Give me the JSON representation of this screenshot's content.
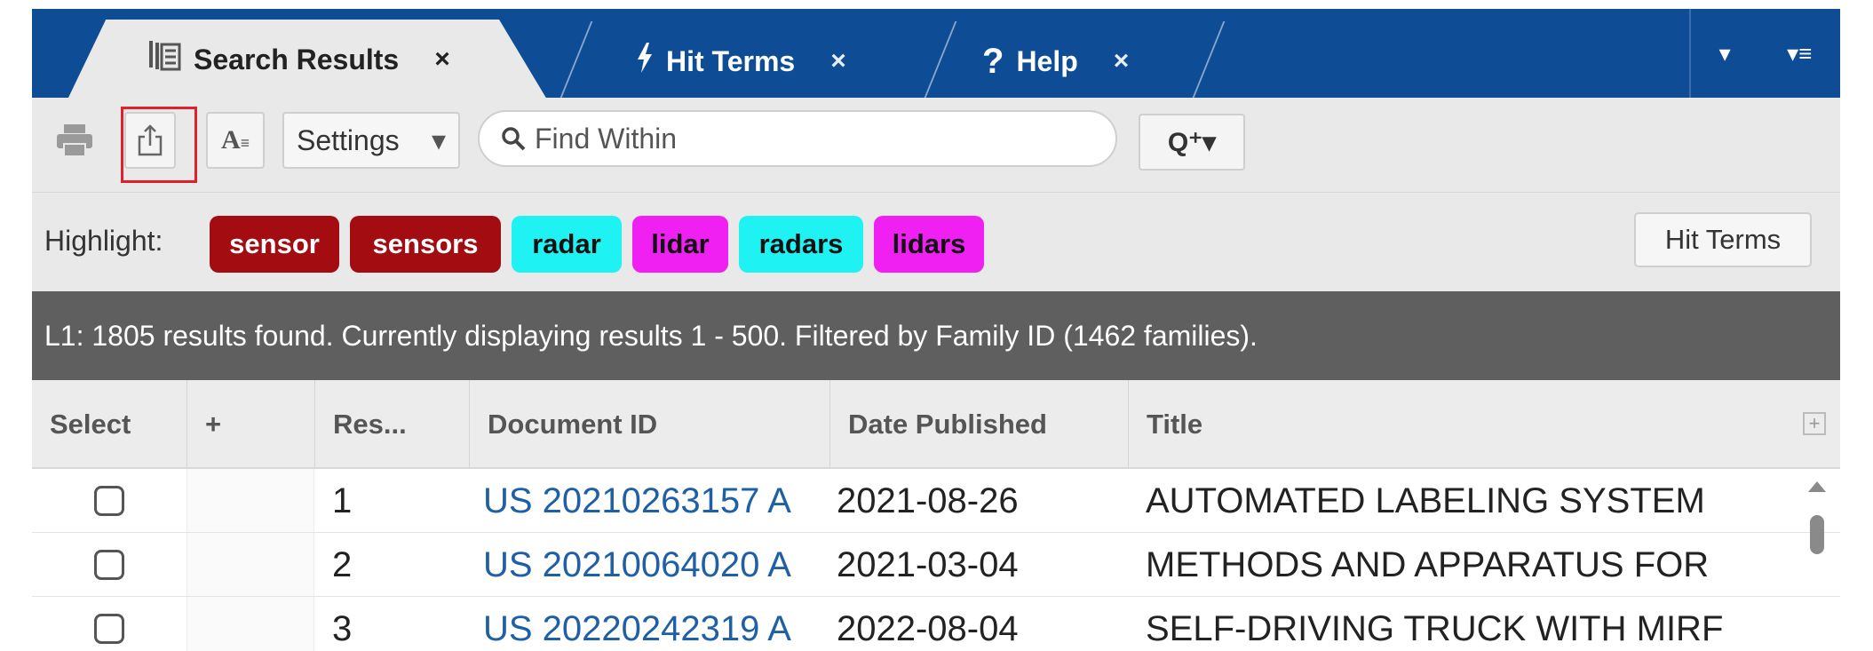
{
  "tabs": [
    {
      "label": "Search Results",
      "icon": "documents-icon",
      "close": "×"
    },
    {
      "label": "Hit Terms",
      "icon": "lightning-icon",
      "close": "×"
    },
    {
      "label": "Help",
      "icon": "question-icon",
      "close": "×"
    }
  ],
  "tabbar_right": {
    "dropdown": "▾",
    "menu": "▾≡"
  },
  "toolbar": {
    "settings_label": "Settings",
    "settings_arrow": "▾",
    "search_placeholder": "Find Within",
    "qplus_label": "Q⁺▾"
  },
  "highlight": {
    "label": "Highlight:",
    "terms": [
      {
        "text": "sensor",
        "bg": "#a30d12",
        "fg": "#ffffff"
      },
      {
        "text": "sensors",
        "bg": "#a30d12",
        "fg": "#ffffff"
      },
      {
        "text": "radar",
        "bg": "#1ff2f2",
        "fg": "#111111"
      },
      {
        "text": "lidar",
        "bg": "#f01ff2",
        "fg": "#111111"
      },
      {
        "text": "radars",
        "bg": "#1ff2f2",
        "fg": "#111111"
      },
      {
        "text": "lidars",
        "bg": "#f01ff2",
        "fg": "#111111"
      }
    ],
    "hit_terms_button": "Hit Terms"
  },
  "status": "L1:  1805 results found. Currently displaying results 1 - 500. Filtered by Family ID (1462 families).",
  "table": {
    "columns": [
      "Select",
      "+",
      "Res...",
      "Document ID",
      "Date Published",
      "Title"
    ],
    "rows": [
      {
        "result": "1",
        "doc_id": "US 20210263157 A",
        "date": "2021-08-26",
        "title": "AUTOMATED LABELING SYSTEM"
      },
      {
        "result": "2",
        "doc_id": "US 20210064020 A",
        "date": "2021-03-04",
        "title": "METHODS AND APPARATUS FOR"
      },
      {
        "result": "3",
        "doc_id": "US 20220242319 A",
        "date": "2022-08-04",
        "title": "SELF-DRIVING TRUCK WITH MIRF"
      }
    ]
  },
  "colors": {
    "tabbar": "#0f4c96",
    "status_bar": "#5f5f5f",
    "link": "#1f5fa5",
    "export_outline": "#e0202a"
  }
}
